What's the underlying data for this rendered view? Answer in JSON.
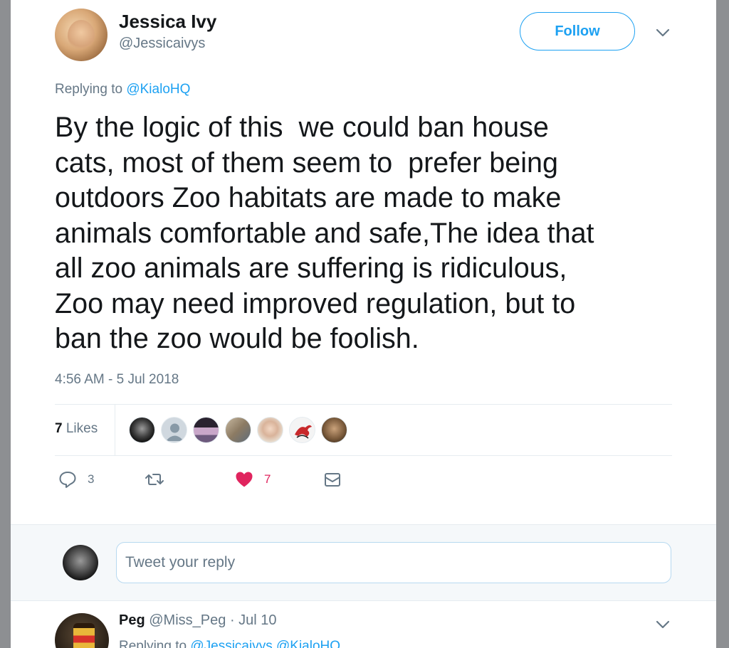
{
  "tweet": {
    "author_name": "Jessica Ivy",
    "author_handle": "@Jessicaivys",
    "follow_label": "Follow",
    "replying_prefix": "Replying to",
    "replying_to": "@KialoHQ",
    "text": "By the logic of this  we could ban house\ncats, most of them seem to  prefer being\noutdoors Zoo habitats are made to make\nanimals comfortable and safe,The idea that\nall zoo animals are suffering is ridiculous,\nZoo may need improved regulation, but to\nban the zoo would be foolish.",
    "timestamp": "4:56 AM - 5 Jul 2018",
    "likes_count": "7",
    "likes_label": "Likes",
    "liker_count_shown": 7
  },
  "actions": {
    "reply_count": "3",
    "retweet_count": "",
    "like_count": "7"
  },
  "reply_box": {
    "placeholder": "Tweet your reply"
  },
  "next_reply": {
    "author_name": "Peg",
    "author_handle": "@Miss_Peg",
    "separator": "·",
    "date": "Jul 10",
    "replying_prefix": "Replying to",
    "replying_to": "@Jessicaivys @KialoHQ"
  },
  "colors": {
    "accent": "#1da1f2",
    "like_red": "#e0245e",
    "muted": "#657786",
    "text": "#14171a",
    "backdrop": "#8d8f92"
  }
}
